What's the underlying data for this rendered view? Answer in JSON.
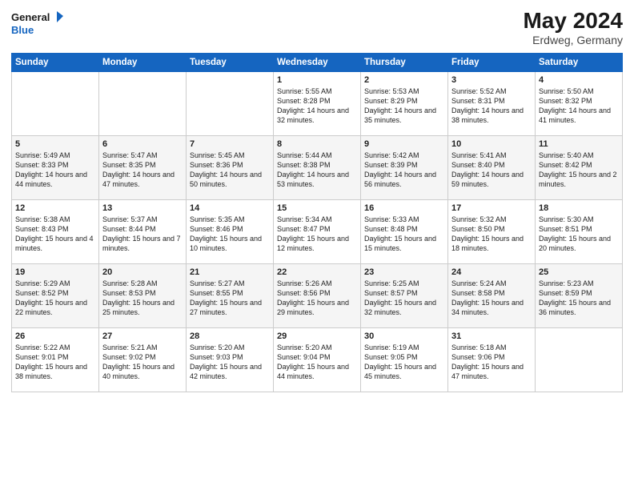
{
  "header": {
    "logo_line1": "General",
    "logo_line2": "Blue",
    "month_year": "May 2024",
    "location": "Erdweg, Germany"
  },
  "days_of_week": [
    "Sunday",
    "Monday",
    "Tuesday",
    "Wednesday",
    "Thursday",
    "Friday",
    "Saturday"
  ],
  "weeks": [
    [
      {
        "day": "",
        "content": ""
      },
      {
        "day": "",
        "content": ""
      },
      {
        "day": "",
        "content": ""
      },
      {
        "day": "1",
        "content": "Sunrise: 5:55 AM\nSunset: 8:28 PM\nDaylight: 14 hours\nand 32 minutes."
      },
      {
        "day": "2",
        "content": "Sunrise: 5:53 AM\nSunset: 8:29 PM\nDaylight: 14 hours\nand 35 minutes."
      },
      {
        "day": "3",
        "content": "Sunrise: 5:52 AM\nSunset: 8:31 PM\nDaylight: 14 hours\nand 38 minutes."
      },
      {
        "day": "4",
        "content": "Sunrise: 5:50 AM\nSunset: 8:32 PM\nDaylight: 14 hours\nand 41 minutes."
      }
    ],
    [
      {
        "day": "5",
        "content": "Sunrise: 5:49 AM\nSunset: 8:33 PM\nDaylight: 14 hours\nand 44 minutes."
      },
      {
        "day": "6",
        "content": "Sunrise: 5:47 AM\nSunset: 8:35 PM\nDaylight: 14 hours\nand 47 minutes."
      },
      {
        "day": "7",
        "content": "Sunrise: 5:45 AM\nSunset: 8:36 PM\nDaylight: 14 hours\nand 50 minutes."
      },
      {
        "day": "8",
        "content": "Sunrise: 5:44 AM\nSunset: 8:38 PM\nDaylight: 14 hours\nand 53 minutes."
      },
      {
        "day": "9",
        "content": "Sunrise: 5:42 AM\nSunset: 8:39 PM\nDaylight: 14 hours\nand 56 minutes."
      },
      {
        "day": "10",
        "content": "Sunrise: 5:41 AM\nSunset: 8:40 PM\nDaylight: 14 hours\nand 59 minutes."
      },
      {
        "day": "11",
        "content": "Sunrise: 5:40 AM\nSunset: 8:42 PM\nDaylight: 15 hours\nand 2 minutes."
      }
    ],
    [
      {
        "day": "12",
        "content": "Sunrise: 5:38 AM\nSunset: 8:43 PM\nDaylight: 15 hours\nand 4 minutes."
      },
      {
        "day": "13",
        "content": "Sunrise: 5:37 AM\nSunset: 8:44 PM\nDaylight: 15 hours\nand 7 minutes."
      },
      {
        "day": "14",
        "content": "Sunrise: 5:35 AM\nSunset: 8:46 PM\nDaylight: 15 hours\nand 10 minutes."
      },
      {
        "day": "15",
        "content": "Sunrise: 5:34 AM\nSunset: 8:47 PM\nDaylight: 15 hours\nand 12 minutes."
      },
      {
        "day": "16",
        "content": "Sunrise: 5:33 AM\nSunset: 8:48 PM\nDaylight: 15 hours\nand 15 minutes."
      },
      {
        "day": "17",
        "content": "Sunrise: 5:32 AM\nSunset: 8:50 PM\nDaylight: 15 hours\nand 18 minutes."
      },
      {
        "day": "18",
        "content": "Sunrise: 5:30 AM\nSunset: 8:51 PM\nDaylight: 15 hours\nand 20 minutes."
      }
    ],
    [
      {
        "day": "19",
        "content": "Sunrise: 5:29 AM\nSunset: 8:52 PM\nDaylight: 15 hours\nand 22 minutes."
      },
      {
        "day": "20",
        "content": "Sunrise: 5:28 AM\nSunset: 8:53 PM\nDaylight: 15 hours\nand 25 minutes."
      },
      {
        "day": "21",
        "content": "Sunrise: 5:27 AM\nSunset: 8:55 PM\nDaylight: 15 hours\nand 27 minutes."
      },
      {
        "day": "22",
        "content": "Sunrise: 5:26 AM\nSunset: 8:56 PM\nDaylight: 15 hours\nand 29 minutes."
      },
      {
        "day": "23",
        "content": "Sunrise: 5:25 AM\nSunset: 8:57 PM\nDaylight: 15 hours\nand 32 minutes."
      },
      {
        "day": "24",
        "content": "Sunrise: 5:24 AM\nSunset: 8:58 PM\nDaylight: 15 hours\nand 34 minutes."
      },
      {
        "day": "25",
        "content": "Sunrise: 5:23 AM\nSunset: 8:59 PM\nDaylight: 15 hours\nand 36 minutes."
      }
    ],
    [
      {
        "day": "26",
        "content": "Sunrise: 5:22 AM\nSunset: 9:01 PM\nDaylight: 15 hours\nand 38 minutes."
      },
      {
        "day": "27",
        "content": "Sunrise: 5:21 AM\nSunset: 9:02 PM\nDaylight: 15 hours\nand 40 minutes."
      },
      {
        "day": "28",
        "content": "Sunrise: 5:20 AM\nSunset: 9:03 PM\nDaylight: 15 hours\nand 42 minutes."
      },
      {
        "day": "29",
        "content": "Sunrise: 5:20 AM\nSunset: 9:04 PM\nDaylight: 15 hours\nand 44 minutes."
      },
      {
        "day": "30",
        "content": "Sunrise: 5:19 AM\nSunset: 9:05 PM\nDaylight: 15 hours\nand 45 minutes."
      },
      {
        "day": "31",
        "content": "Sunrise: 5:18 AM\nSunset: 9:06 PM\nDaylight: 15 hours\nand 47 minutes."
      },
      {
        "day": "",
        "content": ""
      }
    ]
  ]
}
